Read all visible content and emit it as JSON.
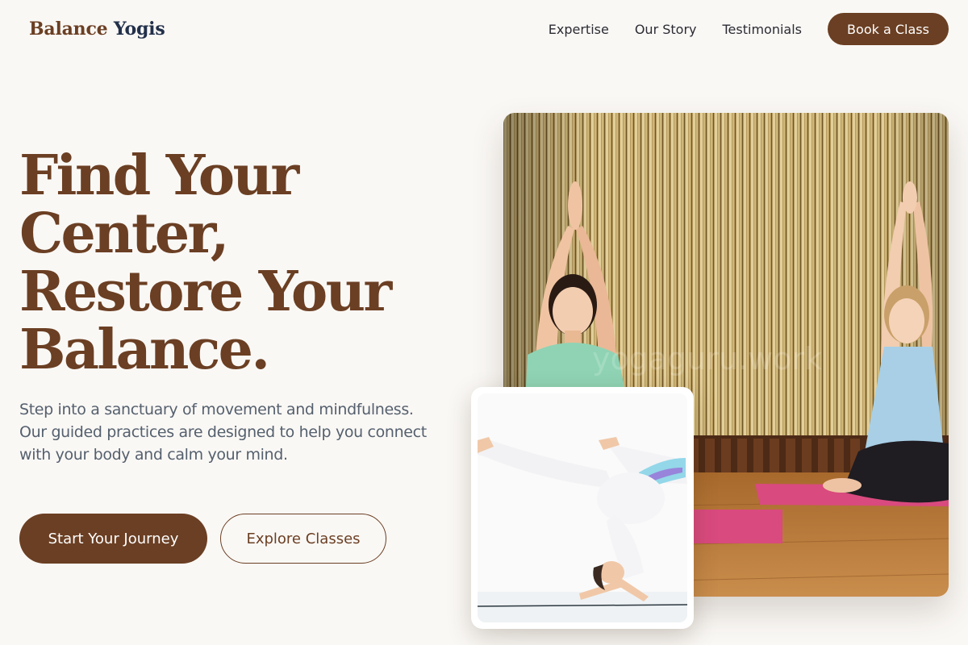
{
  "brand": {
    "name_part1": "Balance",
    "name_part2": "Yogis"
  },
  "nav": {
    "links": [
      "Expertise",
      "Our Story",
      "Testimonials"
    ],
    "cta": "Book a Class"
  },
  "hero": {
    "headline_lines": [
      "Find Your",
      "Center,",
      "Restore Your",
      "Balance."
    ],
    "description": "Step into a sanctuary of movement and mindfulness. Our guided practices are designed to help you connect with your body and calm your mind.",
    "primary_button": "Start Your Journey",
    "secondary_button": "Explore Classes"
  },
  "colors": {
    "brand_brown": "#6b3f23",
    "brand_navy": "#22304a",
    "page_background": "#faf8f5",
    "body_text": "#55606e",
    "mat_pink": "#d94a7e"
  },
  "images": {
    "main": "yoga-class-photo",
    "inset": "headstand-pose-photo"
  }
}
